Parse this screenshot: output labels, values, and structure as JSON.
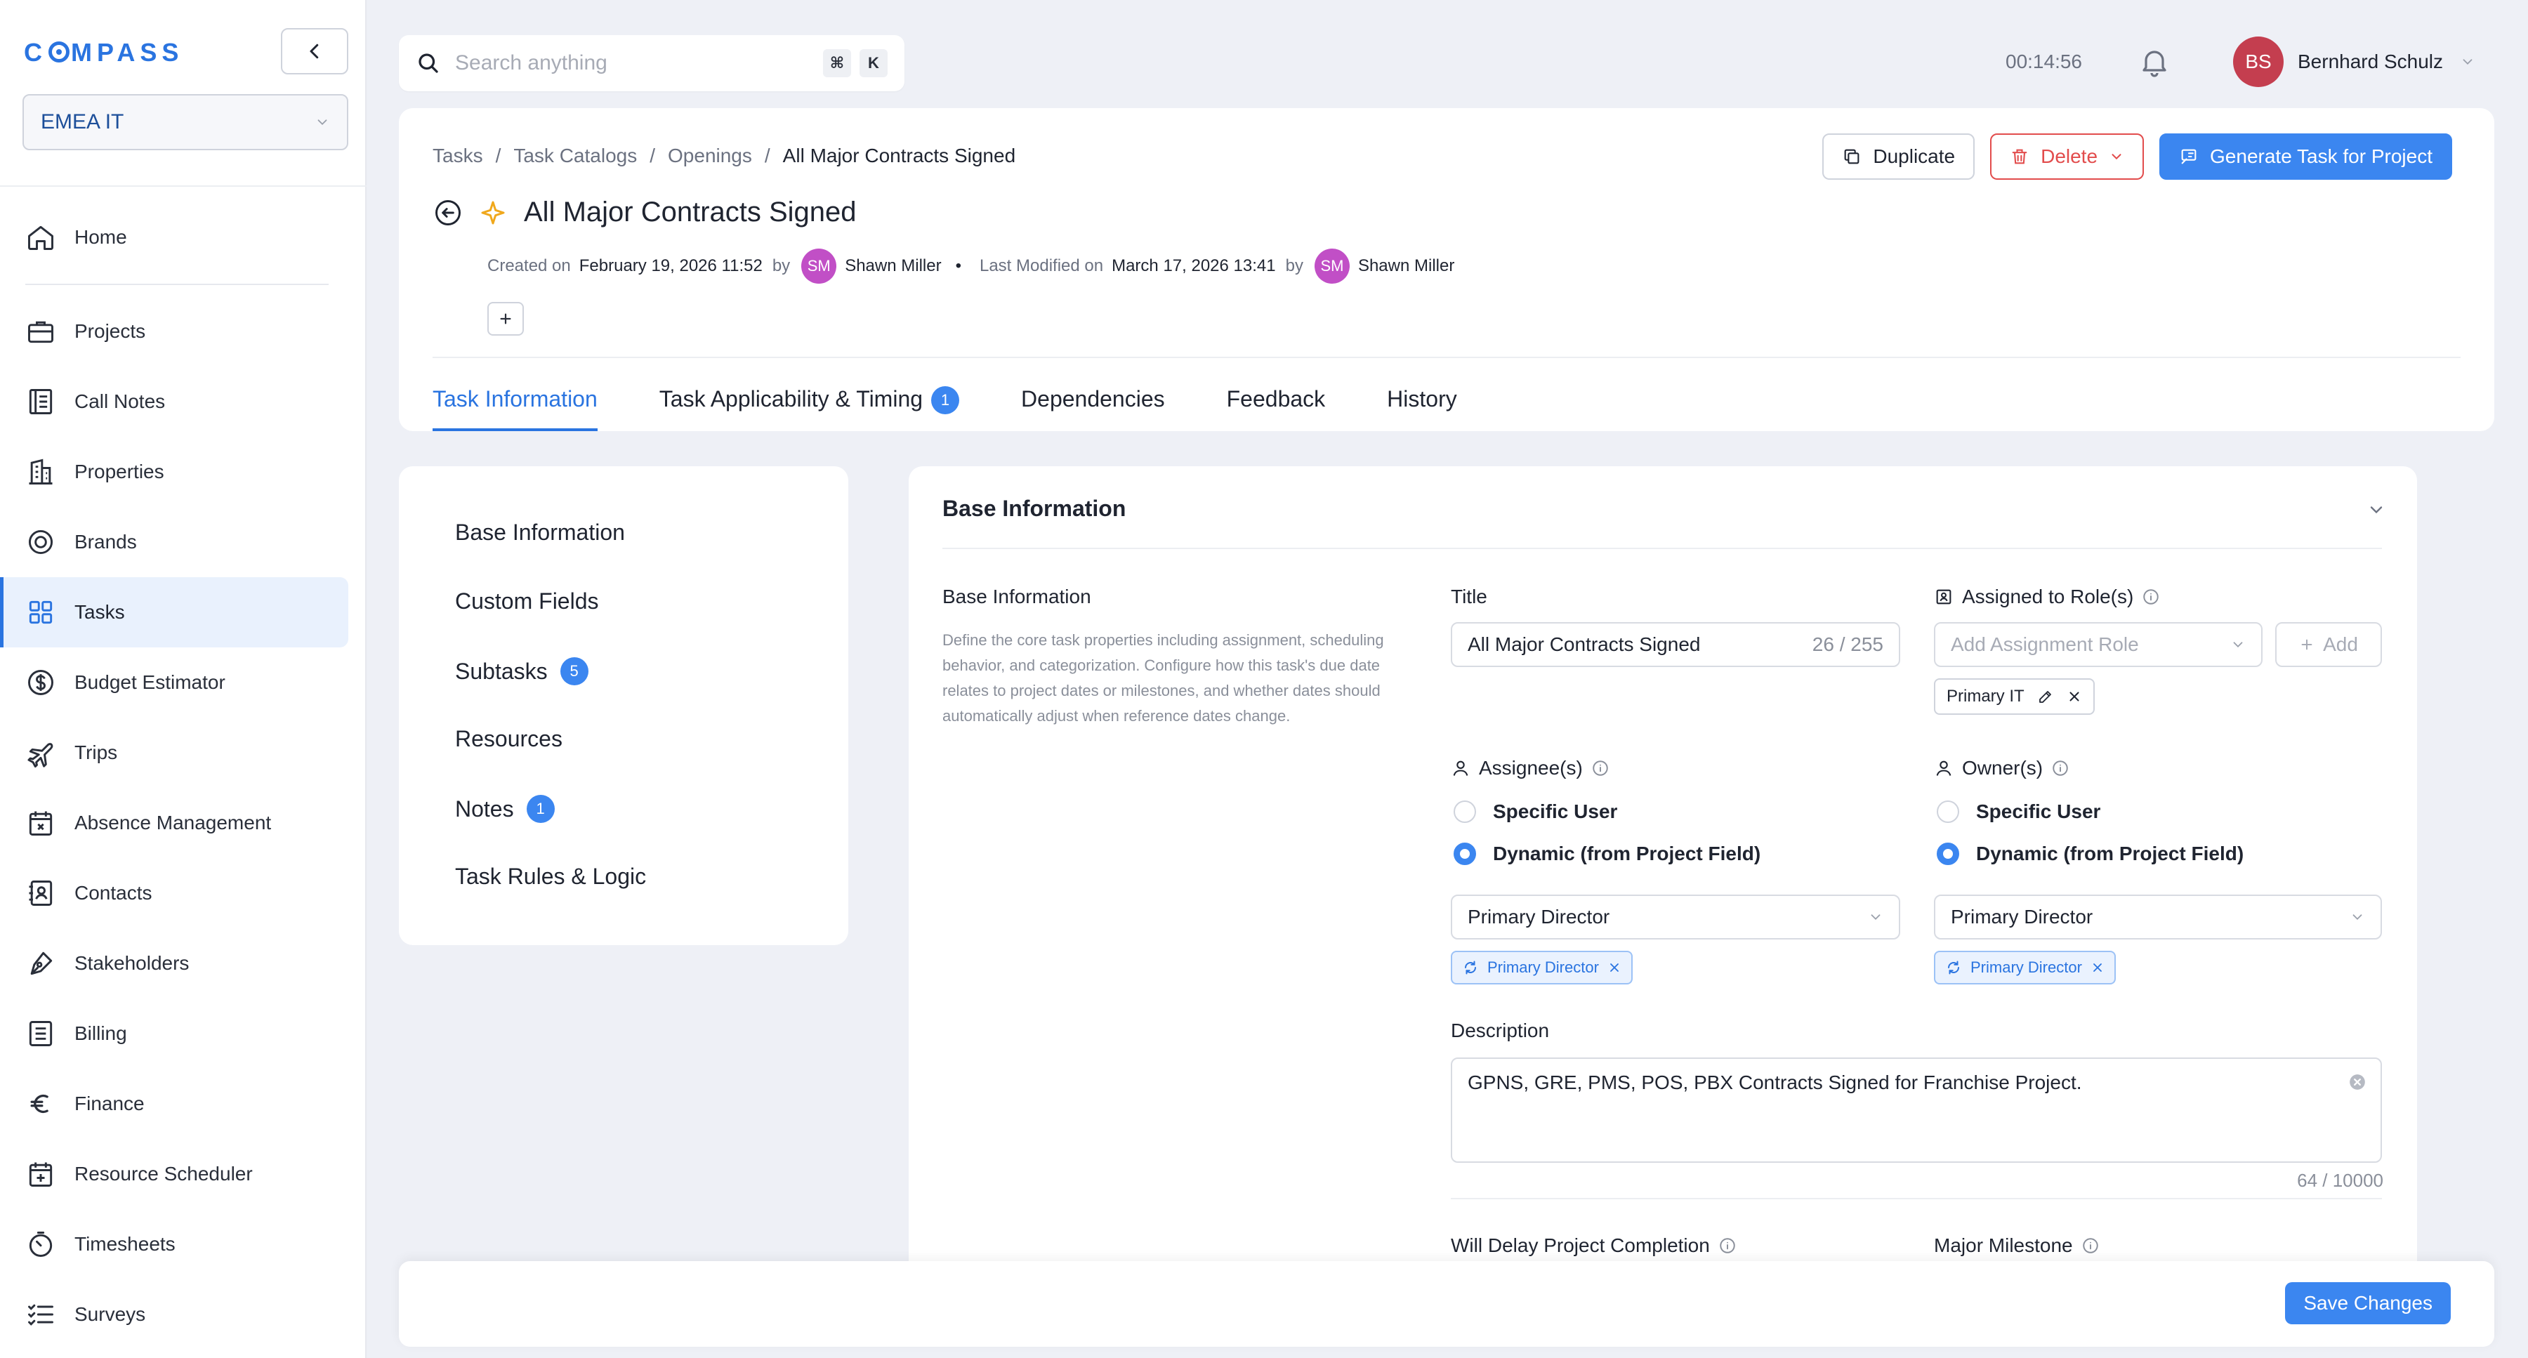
{
  "sidebar": {
    "logo": "COMPASS",
    "workspace": "EMEA IT",
    "items": [
      {
        "label": "Home",
        "icon": "home-icon"
      },
      {
        "label": "Projects",
        "icon": "briefcase-icon"
      },
      {
        "label": "Call Notes",
        "icon": "notebook-icon"
      },
      {
        "label": "Properties",
        "icon": "building-icon"
      },
      {
        "label": "Brands",
        "icon": "badge-icon"
      },
      {
        "label": "Tasks",
        "icon": "grid-icon",
        "active": true
      },
      {
        "label": "Budget Estimator",
        "icon": "dollar-icon"
      },
      {
        "label": "Trips",
        "icon": "plane-icon"
      },
      {
        "label": "Absence Management",
        "icon": "calendar-x-icon"
      },
      {
        "label": "Contacts",
        "icon": "contact-icon"
      },
      {
        "label": "Stakeholders",
        "icon": "pen-icon"
      },
      {
        "label": "Billing",
        "icon": "list-icon"
      },
      {
        "label": "Finance",
        "icon": "euro-icon"
      },
      {
        "label": "Resource Scheduler",
        "icon": "calendar-plus-icon"
      },
      {
        "label": "Timesheets",
        "icon": "stopwatch-icon"
      },
      {
        "label": "Surveys",
        "icon": "checklist-icon"
      }
    ]
  },
  "topbar": {
    "search_placeholder": "Search anything",
    "kbd": [
      "⌘",
      "K"
    ],
    "timer": "00:14:56",
    "user_initials": "BS",
    "user_name": "Bernhard Schulz"
  },
  "header": {
    "breadcrumb": [
      "Tasks",
      "Task Catalogs",
      "Openings",
      "All Major Contracts Signed"
    ],
    "title": "All Major Contracts Signed",
    "created_label": "Created on",
    "created_date": "February 19, 2026 11:52",
    "by": "by",
    "creator_initials": "SM",
    "creator_name": "Shawn Miller",
    "modified_label": "Last Modified on",
    "modified_date": "March 17, 2026 13:41",
    "modifier_initials": "SM",
    "modifier_name": "Shawn Miller",
    "actions": {
      "duplicate": "Duplicate",
      "delete": "Delete",
      "generate": "Generate Task for Project"
    },
    "tabs": [
      {
        "label": "Task Information",
        "active": true
      },
      {
        "label": "Task Applicability & Timing",
        "count": "1"
      },
      {
        "label": "Dependencies"
      },
      {
        "label": "Feedback"
      },
      {
        "label": "History"
      }
    ]
  },
  "section_nav": [
    {
      "label": "Base Information"
    },
    {
      "label": "Custom Fields"
    },
    {
      "label": "Subtasks",
      "count": "5"
    },
    {
      "label": "Resources"
    },
    {
      "label": "Notes",
      "count": "1"
    },
    {
      "label": "Task Rules & Logic"
    }
  ],
  "form": {
    "heading": "Base Information",
    "sub_title": "Base Information",
    "sub_desc": "Define the core task properties including assignment, scheduling behavior, and categorization. Configure how this task's due date relates to project dates or milestones, and whether dates should automatically adjust when reference dates change.",
    "title_label": "Title",
    "title_value": "All Major Contracts Signed",
    "title_counter": "26 / 255",
    "roles_label": "Assigned to Role(s)",
    "roles_placeholder": "Add Assignment Role",
    "roles_add": "Add",
    "roles_chip": "Primary IT",
    "assignee_label": "Assignee(s)",
    "owner_label": "Owner(s)",
    "radio_specific": "Specific User",
    "radio_dynamic": "Dynamic (from Project Field)",
    "assignee_select": "Primary Director",
    "assignee_chip": "Primary Director",
    "owner_select": "Primary Director",
    "owner_chip": "Primary Director",
    "description_label": "Description",
    "description_value": "GPNS, GRE, PMS, POS, PBX Contracts Signed for Franchise Project.",
    "description_counter": "64 / 10000",
    "delay_label": "Will Delay Project Completion",
    "milestone_label": "Major Milestone"
  },
  "footer": {
    "save": "Save Changes"
  },
  "colors": {
    "accent": "#3b86f0",
    "danger": "#e24c4c",
    "avatar_user": "#c43e4f",
    "avatar_sm": "#c14fc6"
  }
}
